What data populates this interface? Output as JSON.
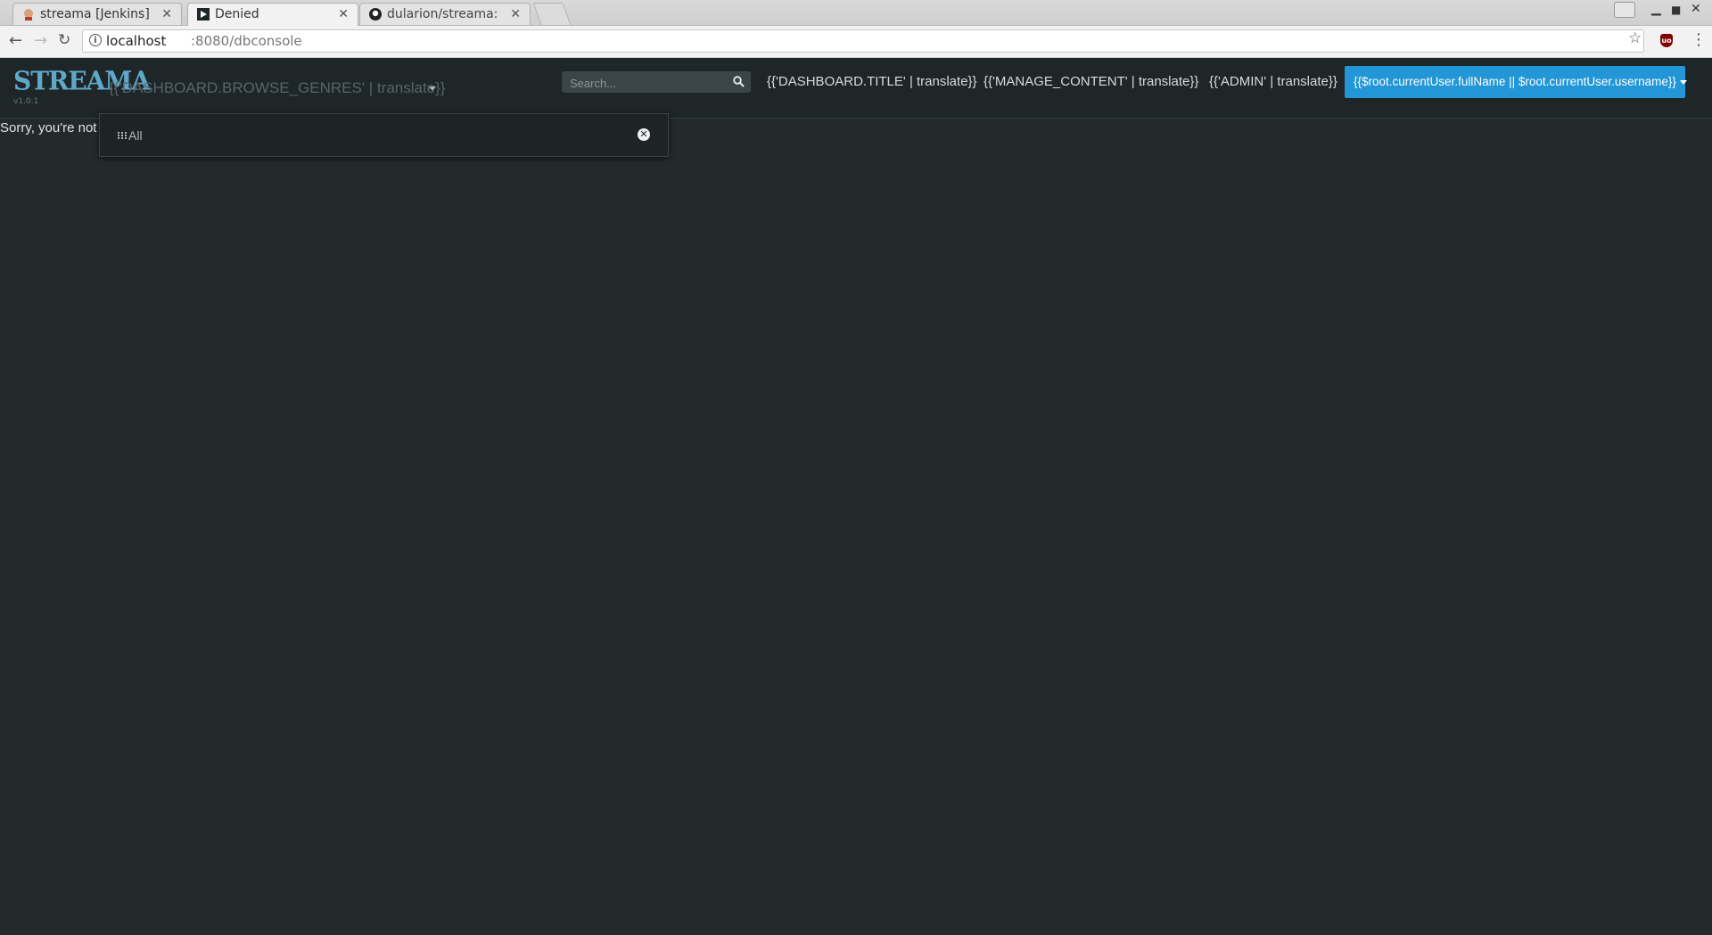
{
  "browser": {
    "tabs": [
      {
        "title": "streama [Jenkins]",
        "favicon": "jenkins-icon"
      },
      {
        "title": "Denied",
        "favicon": "streama-play-icon",
        "active": true
      },
      {
        "title": "dularion/streama: It",
        "favicon": "github-icon"
      }
    ],
    "url_host": "localhost",
    "url_path": ":8080/dbconsole"
  },
  "navbar": {
    "logo": "STREAMA",
    "version": "v1.0.1",
    "browse_genres": "{{'DASHBOARD.BROWSE_GENRES' | translate}}",
    "search_placeholder": "Search...",
    "dashboard": "{{'DASHBOARD.TITLE' | translate}}",
    "manage_content": "{{'MANAGE_CONTENT' | translate}}",
    "admin": "{{'ADMIN' | translate}}",
    "user": "{{$root.currentUser.fullName || $root.currentUser.username}}",
    "accent_color": "#2296d6"
  },
  "content": {
    "message": "Sorry, you're not a"
  },
  "genres_dropdown": {
    "all_label": "All"
  }
}
